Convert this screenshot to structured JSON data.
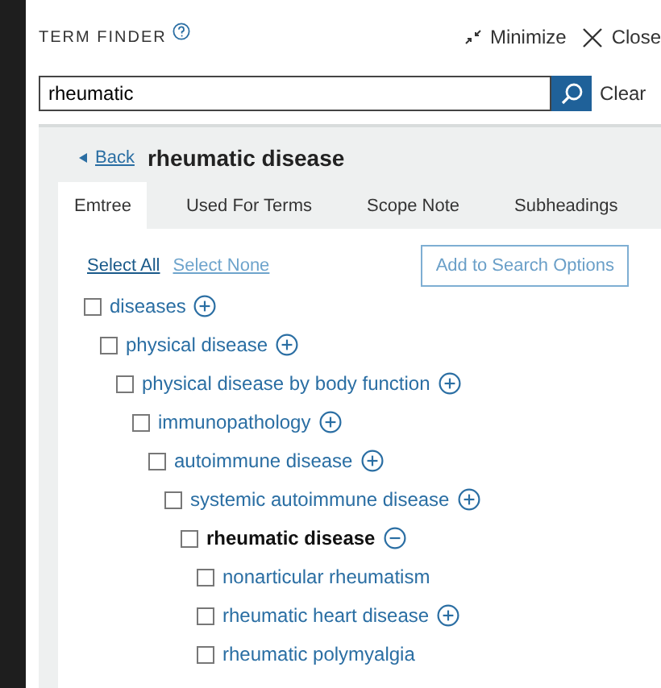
{
  "header": {
    "title": "TERM FINDER",
    "minimize": "Minimize",
    "close": "Close"
  },
  "search": {
    "value": "rheumatic",
    "clear": "Clear"
  },
  "back": "Back",
  "heading": "rheumatic disease",
  "tabs": [
    {
      "label": "Emtree",
      "selected": true
    },
    {
      "label": "Used For Terms",
      "selected": false
    },
    {
      "label": "Scope Note",
      "selected": false
    },
    {
      "label": "Subheadings",
      "selected": false
    }
  ],
  "select_all": "Select All",
  "select_none": "Select None",
  "add_button": "Add to Search Options",
  "tree": [
    {
      "label": "diseases",
      "checked": false,
      "current": false,
      "expanded": false,
      "children": [
        {
          "label": "physical disease",
          "checked": false,
          "current": false,
          "expanded": false,
          "children": [
            {
              "label": "physical disease by body function",
              "checked": false,
              "current": false,
              "expanded": false,
              "children": [
                {
                  "label": "immunopathology",
                  "checked": false,
                  "current": false,
                  "expanded": false,
                  "children": [
                    {
                      "label": "autoimmune disease",
                      "checked": false,
                      "current": false,
                      "expanded": false,
                      "children": [
                        {
                          "label": "systemic autoimmune disease",
                          "checked": false,
                          "current": false,
                          "expanded": false,
                          "children": [
                            {
                              "label": "rheumatic disease",
                              "checked": false,
                              "current": true,
                              "expanded": true,
                              "children": [
                                {
                                  "label": "nonarticular rheumatism",
                                  "checked": false,
                                  "current": false
                                },
                                {
                                  "label": "rheumatic heart disease",
                                  "checked": false,
                                  "current": false,
                                  "expanded": false
                                },
                                {
                                  "label": "rheumatic polymyalgia",
                                  "checked": false,
                                  "current": false
                                }
                              ]
                            }
                          ]
                        }
                      ]
                    }
                  ]
                }
              ]
            }
          ]
        }
      ]
    }
  ]
}
